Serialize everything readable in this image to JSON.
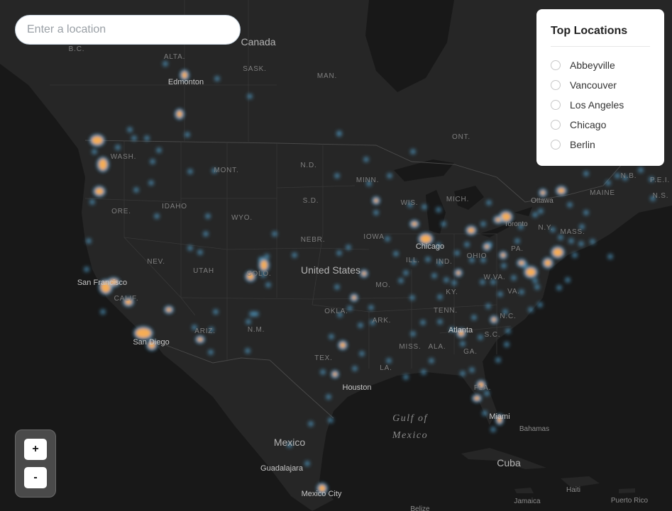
{
  "search": {
    "placeholder": "Enter a location"
  },
  "top_locations": {
    "title": "Top Locations",
    "items": [
      "Abbeyville",
      "Vancouver",
      "Los Angeles",
      "Chicago",
      "Berlin"
    ]
  },
  "zoom": {
    "in_label": "+",
    "out_label": "-"
  },
  "colors": {
    "background": "#1c1c1c",
    "land": "#262626",
    "water": "#181818",
    "hot": "#f6ad55",
    "cool": "#5ab4e6"
  },
  "map_labels": {
    "countries": [
      "Canada",
      "United States",
      "Mexico",
      "Cuba"
    ],
    "water_bodies": [
      "Gulf of Mexico"
    ],
    "regions": [
      "B.C.",
      "ALTA.",
      "SASK.",
      "MAN.",
      "ONT.",
      "WASH.",
      "ORE.",
      "IDAHO",
      "MONT.",
      "WYO.",
      "N.D.",
      "S.D.",
      "NEBR.",
      "MINN.",
      "IOWA",
      "WIS.",
      "MICH.",
      "ILL.",
      "IND.",
      "OHIO",
      "PA.",
      "N.Y.",
      "MASS.",
      "MAINE",
      "N.B.",
      "P.E.I.",
      "N.S.",
      "NEV.",
      "UTAH",
      "COLO.",
      "CALIF.",
      "ARIZ.",
      "N.M.",
      "OKLA.",
      "TEX.",
      "MO.",
      "KY.",
      "W.VA.",
      "VA.",
      "TENN.",
      "N.C.",
      "S.C.",
      "GA.",
      "ALA.",
      "MISS.",
      "ARK.",
      "LA.",
      "FLA."
    ],
    "cities": [
      "Edmonton",
      "Ottawa",
      "Toronto",
      "Chicago",
      "San Francisco",
      "San Diego",
      "Houston",
      "Atlanta",
      "Miami",
      "Bahamas",
      "Guadalajara",
      "Mexico City",
      "Jamaica",
      "Haiti",
      "Puerto Rico",
      "Belize"
    ]
  }
}
